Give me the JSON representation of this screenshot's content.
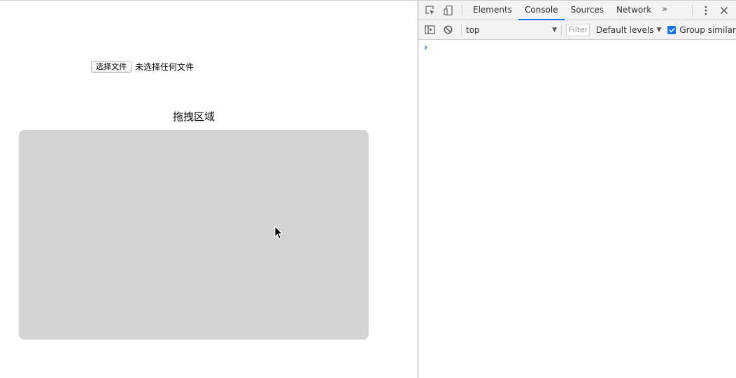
{
  "page": {
    "file_button_label": "选择文件",
    "file_status": "未选择任何文件",
    "drop_title": "拖拽区域"
  },
  "devtools": {
    "tabs": [
      "Elements",
      "Console",
      "Sources",
      "Network"
    ],
    "active_tab": "Console",
    "more_tabs_glyph": "»",
    "context": "top",
    "filter_placeholder": "Filter",
    "levels": "Default levels",
    "group_similar": "Group similar",
    "group_similar_checked": true,
    "prompt": "›"
  },
  "colors": {
    "drop_zone": "#d3d3d3",
    "accent": "#1a73e8"
  }
}
